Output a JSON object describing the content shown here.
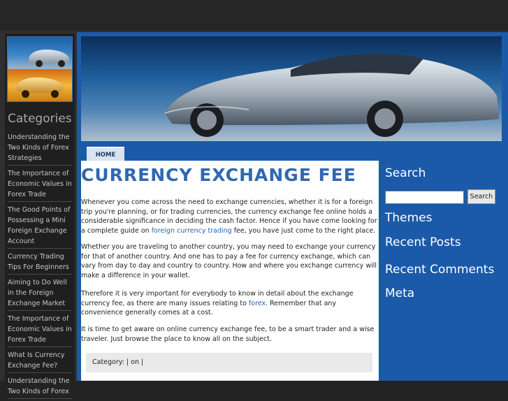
{
  "nav": {
    "home": "HOME"
  },
  "categories": {
    "title": "Categories",
    "items": [
      "Understanding the Two Kinds of Forex Strategies",
      "The Importance of Economic Values in Forex Trade",
      "The Good Points of Possessing a Mini Foreign Exchange Account",
      "Currency Trading Tips For Beginners",
      "Aiming to Do Well in the Foreign Exchange Market",
      "The Importance of Economic Values in Forex Trade",
      "What Is Currency Exchange Fee?",
      "Understanding the Two Kinds of Forex"
    ]
  },
  "post": {
    "title": "CURRENCY EXCHANGE FEE",
    "p1_before": "Whenever you come across the need to exchange currencies, whether it is for a foreign trip you're planning, or for trading currencies, the currency exchange fee online holds a considerable significance in deciding the cash factor. Hence if you have come looking for a complete guide on ",
    "p1_link": "foreign currency trading",
    "p1_after": " fee, you have just come to the right place.",
    "p2": "Whether you are traveling to another country, you may need to exchange your currency for that of another country. And one has to pay a fee for currency exchange, which can vary from day to day and country to country. How and where you exchange currency will make a difference in your wallet.",
    "p3_before": "Therefore it is very important for everybody to know in detail about the exchange currency fee, as there are many issues relating to ",
    "p3_link": "forex",
    "p3_after": ". Remember that any convenience generally comes at a cost.",
    "p4": "It is time to get aware on online currency exchange fee, to be a smart trader and a wise traveler. Just browse the place to know all on the subject.",
    "meta": "Category: | on |"
  },
  "sidebar": {
    "search_title": "Search",
    "search_value": "",
    "search_button": "Search",
    "themes": "Themes",
    "recent_posts": "Recent Posts",
    "recent_comments": "Recent Comments",
    "meta": "Meta"
  }
}
